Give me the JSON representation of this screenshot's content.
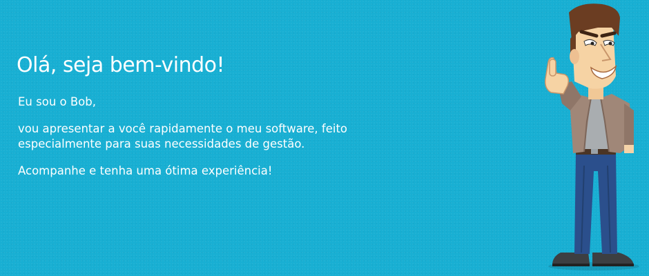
{
  "welcome": {
    "title": "Olá, seja bem-vindo!",
    "intro": "Eu sou o Bob,",
    "description_line1": "vou apresentar a você rapidamente o meu software, feito",
    "description_line2": "especialmente para suas necessidades de gestão.",
    "closing": "Acompanhe e tenha uma ótima experiência!"
  },
  "colors": {
    "background": "#18afd3",
    "text": "#ffffff"
  },
  "mascot": {
    "name": "Bob",
    "icon": "cartoon-man-thumbs-up-icon"
  }
}
